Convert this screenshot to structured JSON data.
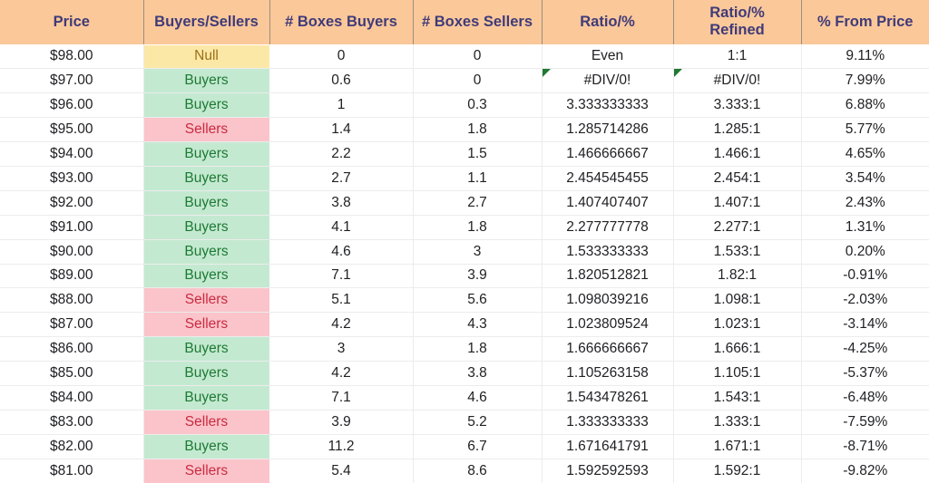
{
  "table": {
    "columns": [
      {
        "key": "price",
        "label": "Price",
        "name": "column-header-price"
      },
      {
        "key": "status",
        "label": "Buyers/Sellers",
        "name": "column-header-buyers-sellers"
      },
      {
        "key": "boxbuy",
        "label": "# Boxes Buyers",
        "name": "column-header-boxes-buyers"
      },
      {
        "key": "boxsell",
        "label": "# Boxes Sellers",
        "name": "column-header-boxes-sellers"
      },
      {
        "key": "ratio",
        "label": "Ratio/%",
        "name": "column-header-ratio"
      },
      {
        "key": "ratioref",
        "label": "Ratio/%\nRefined",
        "name": "column-header-ratio-refined"
      },
      {
        "key": "pctfrom",
        "label": "% From Price",
        "name": "column-header-pct-from-price"
      }
    ],
    "colors": {
      "header_background": "#fbc89a",
      "header_text": "#3f3b78",
      "null_background": "#fce8a6",
      "null_text": "#9c6f16",
      "buyers_background": "#c4e9d1",
      "buyers_text": "#1d7a33",
      "sellers_background": "#fac4ca",
      "sellers_text": "#cc2a41",
      "error_flag": "#1e7a32",
      "grid_line": "#ececec"
    },
    "rows": [
      {
        "price": "$98.00",
        "status": "Null",
        "status_kind": "null",
        "boxbuy": "0",
        "boxsell": "0",
        "ratio": "Even",
        "ratio_flag": false,
        "ratioref": "1:1",
        "ratioref_flag": false,
        "pctfrom": "9.11%"
      },
      {
        "price": "$97.00",
        "status": "Buyers",
        "status_kind": "buyers",
        "boxbuy": "0.6",
        "boxsell": "0",
        "ratio": "#DIV/0!",
        "ratio_flag": true,
        "ratioref": "#DIV/0!",
        "ratioref_flag": true,
        "pctfrom": "7.99%"
      },
      {
        "price": "$96.00",
        "status": "Buyers",
        "status_kind": "buyers",
        "boxbuy": "1",
        "boxsell": "0.3",
        "ratio": "3.333333333",
        "ratio_flag": false,
        "ratioref": "3.333:1",
        "ratioref_flag": false,
        "pctfrom": "6.88%"
      },
      {
        "price": "$95.00",
        "status": "Sellers",
        "status_kind": "sellers",
        "boxbuy": "1.4",
        "boxsell": "1.8",
        "ratio": "1.285714286",
        "ratio_flag": false,
        "ratioref": "1.285:1",
        "ratioref_flag": false,
        "pctfrom": "5.77%"
      },
      {
        "price": "$94.00",
        "status": "Buyers",
        "status_kind": "buyers",
        "boxbuy": "2.2",
        "boxsell": "1.5",
        "ratio": "1.466666667",
        "ratio_flag": false,
        "ratioref": "1.466:1",
        "ratioref_flag": false,
        "pctfrom": "4.65%"
      },
      {
        "price": "$93.00",
        "status": "Buyers",
        "status_kind": "buyers",
        "boxbuy": "2.7",
        "boxsell": "1.1",
        "ratio": "2.454545455",
        "ratio_flag": false,
        "ratioref": "2.454:1",
        "ratioref_flag": false,
        "pctfrom": "3.54%"
      },
      {
        "price": "$92.00",
        "status": "Buyers",
        "status_kind": "buyers",
        "boxbuy": "3.8",
        "boxsell": "2.7",
        "ratio": "1.407407407",
        "ratio_flag": false,
        "ratioref": "1.407:1",
        "ratioref_flag": false,
        "pctfrom": "2.43%"
      },
      {
        "price": "$91.00",
        "status": "Buyers",
        "status_kind": "buyers",
        "boxbuy": "4.1",
        "boxsell": "1.8",
        "ratio": "2.277777778",
        "ratio_flag": false,
        "ratioref": "2.277:1",
        "ratioref_flag": false,
        "pctfrom": "1.31%"
      },
      {
        "price": "$90.00",
        "status": "Buyers",
        "status_kind": "buyers",
        "boxbuy": "4.6",
        "boxsell": "3",
        "ratio": "1.533333333",
        "ratio_flag": false,
        "ratioref": "1.533:1",
        "ratioref_flag": false,
        "pctfrom": "0.20%"
      },
      {
        "price": "$89.00",
        "status": "Buyers",
        "status_kind": "buyers",
        "boxbuy": "7.1",
        "boxsell": "3.9",
        "ratio": "1.820512821",
        "ratio_flag": false,
        "ratioref": "1.82:1",
        "ratioref_flag": false,
        "pctfrom": "-0.91%"
      },
      {
        "price": "$88.00",
        "status": "Sellers",
        "status_kind": "sellers",
        "boxbuy": "5.1",
        "boxsell": "5.6",
        "ratio": "1.098039216",
        "ratio_flag": false,
        "ratioref": "1.098:1",
        "ratioref_flag": false,
        "pctfrom": "-2.03%"
      },
      {
        "price": "$87.00",
        "status": "Sellers",
        "status_kind": "sellers",
        "boxbuy": "4.2",
        "boxsell": "4.3",
        "ratio": "1.023809524",
        "ratio_flag": false,
        "ratioref": "1.023:1",
        "ratioref_flag": false,
        "pctfrom": "-3.14%"
      },
      {
        "price": "$86.00",
        "status": "Buyers",
        "status_kind": "buyers",
        "boxbuy": "3",
        "boxsell": "1.8",
        "ratio": "1.666666667",
        "ratio_flag": false,
        "ratioref": "1.666:1",
        "ratioref_flag": false,
        "pctfrom": "-4.25%"
      },
      {
        "price": "$85.00",
        "status": "Buyers",
        "status_kind": "buyers",
        "boxbuy": "4.2",
        "boxsell": "3.8",
        "ratio": "1.105263158",
        "ratio_flag": false,
        "ratioref": "1.105:1",
        "ratioref_flag": false,
        "pctfrom": "-5.37%"
      },
      {
        "price": "$84.00",
        "status": "Buyers",
        "status_kind": "buyers",
        "boxbuy": "7.1",
        "boxsell": "4.6",
        "ratio": "1.543478261",
        "ratio_flag": false,
        "ratioref": "1.543:1",
        "ratioref_flag": false,
        "pctfrom": "-6.48%"
      },
      {
        "price": "$83.00",
        "status": "Sellers",
        "status_kind": "sellers",
        "boxbuy": "3.9",
        "boxsell": "5.2",
        "ratio": "1.333333333",
        "ratio_flag": false,
        "ratioref": "1.333:1",
        "ratioref_flag": false,
        "pctfrom": "-7.59%"
      },
      {
        "price": "$82.00",
        "status": "Buyers",
        "status_kind": "buyers",
        "boxbuy": "11.2",
        "boxsell": "6.7",
        "ratio": "1.671641791",
        "ratio_flag": false,
        "ratioref": "1.671:1",
        "ratioref_flag": false,
        "pctfrom": "-8.71%"
      },
      {
        "price": "$81.00",
        "status": "Sellers",
        "status_kind": "sellers",
        "boxbuy": "5.4",
        "boxsell": "8.6",
        "ratio": "1.592592593",
        "ratio_flag": false,
        "ratioref": "1.592:1",
        "ratioref_flag": false,
        "pctfrom": "-9.82%"
      }
    ]
  }
}
